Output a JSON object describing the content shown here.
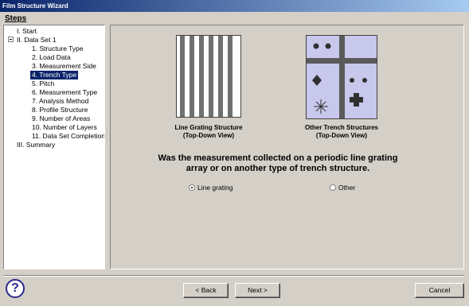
{
  "window": {
    "title": "Film Structure Wizard"
  },
  "steps": {
    "label": "Steps",
    "items": [
      {
        "label": "I. Start"
      },
      {
        "label": "II. Data Set 1"
      },
      {
        "label": "1. Structure Type"
      },
      {
        "label": "2. Load Data"
      },
      {
        "label": "3. Measurement Side"
      },
      {
        "label": "4. Trench Type",
        "selected": true
      },
      {
        "label": "5. Pitch"
      },
      {
        "label": "6. Measurement Type"
      },
      {
        "label": "7. Analysis Method"
      },
      {
        "label": "8. Profile Structure"
      },
      {
        "label": "9. Number of Areas"
      },
      {
        "label": "10. Number of Layers"
      },
      {
        "label": "11. Data Set Completion"
      },
      {
        "label": "III. Summary"
      }
    ]
  },
  "main": {
    "option1": {
      "caption_line1": "Line Grating Structure",
      "caption_line2": "(Top-Down View)"
    },
    "option2": {
      "caption_line1": "Other Trench Structures",
      "caption_line2": "(Top-Down View)"
    },
    "question_line1": "Was the measurement collected on a periodic line grating",
    "question_line2": "array or on another type of trench structure.",
    "radios": {
      "line_grating": {
        "label": "Line grating",
        "checked": true
      },
      "other": {
        "label": "Other",
        "checked": false
      }
    }
  },
  "footer": {
    "help_glyph": "?",
    "back_label": "< Back",
    "next_label": "Next >",
    "cancel_label": "Cancel"
  },
  "colors": {
    "titlebar_start": "#0a246a",
    "titlebar_end": "#a6caf0",
    "selection": "#0a246a",
    "dialog_bg": "#d4d0c8",
    "trench_bg": "#c8c8ec",
    "trench_lines": "#5a5a5a"
  },
  "icons": [
    "help-icon",
    "tree-collapse-icon",
    "radio-icon"
  ]
}
